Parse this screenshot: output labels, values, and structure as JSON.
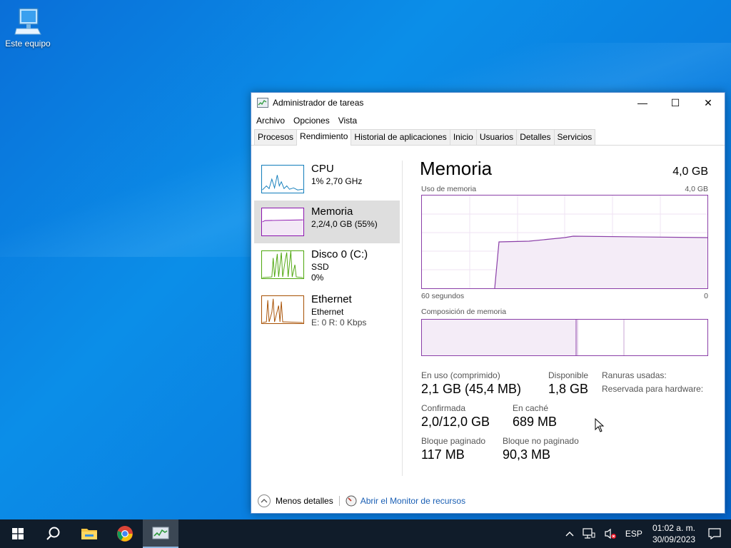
{
  "desktop": {
    "icon_label": "Este equipo"
  },
  "window": {
    "title": "Administrador de tareas",
    "controls": {
      "minimize": "—",
      "maximize": "☐",
      "close": "✕"
    },
    "menu": [
      "Archivo",
      "Opciones",
      "Vista"
    ],
    "tabs": [
      "Procesos",
      "Rendimiento",
      "Historial de aplicaciones",
      "Inicio",
      "Usuarios",
      "Detalles",
      "Servicios"
    ],
    "active_tab": "Rendimiento"
  },
  "sidebar": {
    "items": [
      {
        "name": "CPU",
        "line1": "1%  2,70 GHz",
        "line2": "",
        "color": "#117dbb"
      },
      {
        "name": "Memoria",
        "line1": "2,2/4,0 GB (55%)",
        "line2": "",
        "color": "#8b12ae"
      },
      {
        "name": "Disco 0 (C:)",
        "line1": "SSD",
        "line2": "0%",
        "color": "#4da60c"
      },
      {
        "name": "Ethernet",
        "line1": "Ethernet",
        "line2": "E: 0  R: 0 Kbps",
        "color": "#a74f01"
      }
    ],
    "selected": "Memoria"
  },
  "memory": {
    "title": "Memoria",
    "total": "4,0 GB",
    "usage_label": "Uso de memoria",
    "usage_max": "4,0 GB",
    "time_left": "60 segundos",
    "time_right": "0",
    "composition_label": "Composición de memoria",
    "stats": {
      "in_use_label": "En uso (comprimido)",
      "in_use_value": "2,1 GB (45,4 MB)",
      "available_label": "Disponible",
      "available_value": "1,8 GB",
      "slots_label": "Ranuras usadas:",
      "reserved_label": "Reservada para hardware:",
      "committed_label": "Confirmada",
      "committed_value": "2,0/12,0 GB",
      "cached_label": "En caché",
      "cached_value": "689 MB",
      "paged_label": "Bloque paginado",
      "paged_value": "117 MB",
      "nonpaged_label": "Bloque no paginado",
      "nonpaged_value": "90,3 MB"
    }
  },
  "footer": {
    "less_details": "Menos detalles",
    "resource_monitor": "Abrir el Monitor de recursos"
  },
  "taskbar": {
    "language": "ESP",
    "time": "01:02 a. m.",
    "date": "30/09/2023"
  },
  "colors": {
    "memory_accent": "#8b3fa8",
    "taskbar": "#101c2a",
    "link": "#1a5fb4"
  }
}
